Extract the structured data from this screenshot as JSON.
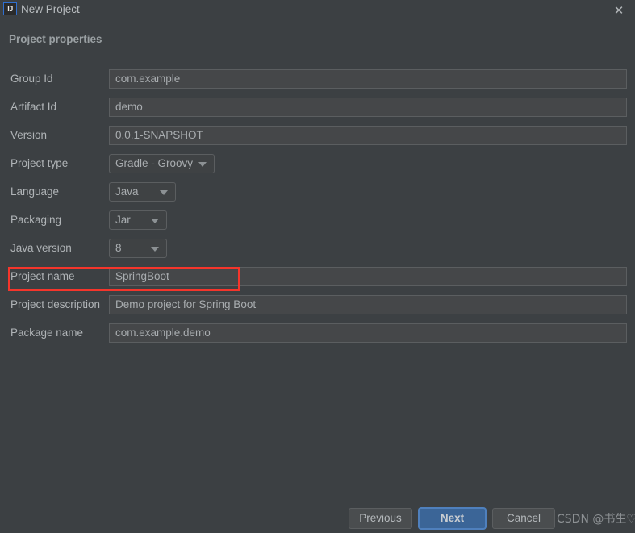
{
  "window": {
    "title": "New Project",
    "app_icon_label": "IJ",
    "close_icon": "✕"
  },
  "section": {
    "title": "Project properties"
  },
  "form": {
    "rows": [
      {
        "label": "Group Id",
        "type": "text",
        "value": "com.example"
      },
      {
        "label": "Artifact Id",
        "type": "text",
        "value": "demo"
      },
      {
        "label": "Version",
        "type": "text",
        "value": "0.0.1-SNAPSHOT"
      },
      {
        "label": "Project type",
        "type": "combo",
        "value": "Gradle - Groovy"
      },
      {
        "label": "Language",
        "type": "combo",
        "value": "Java"
      },
      {
        "label": "Packaging",
        "type": "combo",
        "value": "Jar"
      },
      {
        "label": "Java version",
        "type": "combo",
        "value": "8"
      },
      {
        "label": "Project name",
        "type": "text",
        "value": "SpringBoot"
      },
      {
        "label": "Project description",
        "type": "text",
        "value": "Demo project for Spring Boot"
      },
      {
        "label": "Package name",
        "type": "text",
        "value": "com.example.demo"
      }
    ]
  },
  "annotation": {
    "color": "#f5352b",
    "target_row_label": "Project name"
  },
  "buttons": {
    "previous": "Previous",
    "next": "Next",
    "cancel": "Cancel"
  },
  "watermark": {
    "text": "CSDN @书生♡"
  },
  "colors": {
    "window_background": "#3c4043",
    "field_background": "#454749",
    "field_border": "#5b5e60",
    "primary_button": "#3b6597",
    "primary_button_border": "#4f80bd",
    "text": "#b0b4b7",
    "accent_red": "#f5352b",
    "icon_blue": "#2f6fd0"
  }
}
